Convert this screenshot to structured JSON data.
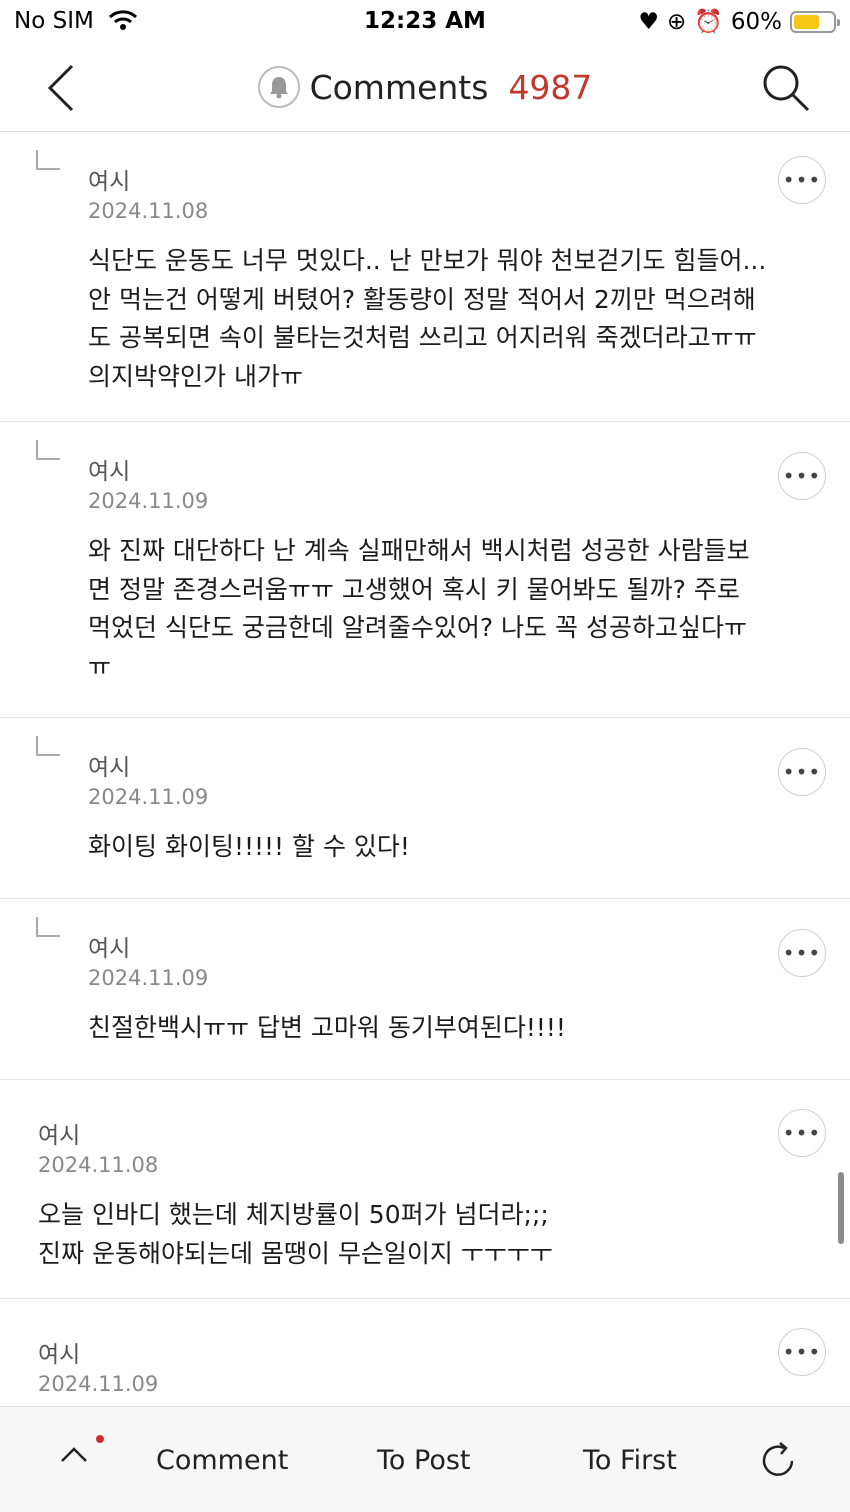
{
  "status_bar": {
    "carrier": "No SIM",
    "time": "12:23 AM",
    "battery": "60%"
  },
  "header": {
    "title": "Comments",
    "count": "4987"
  },
  "comments": [
    {
      "author": "여시",
      "date": "2024.11.08",
      "body": "식단도 운동도 너무 멋있다.. 난 만보가 뭐야 천보걷기도 힘들어...\n안 먹는건 어떻게 버텼어? 활동량이 정말 적어서 2끼만 먹으려해\n도 공복되면 속이 불타는것처럼 쓰리고 어지러워 죽겠더라고ㅠㅠ\n의지박약인가 내가ㅠ"
    },
    {
      "author": "여시",
      "date": "2024.11.09",
      "body": "와 진짜 대단하다 난 계속 실패만해서 백시처럼 성공한 사람들보\n면 정말 존경스러움ㅠㅠ 고생했어 혹시 키 물어봐도 될까? 주로\n먹었던 식단도 궁금한데 알려줄수있어? 나도 꼭 성공하고싶다ㅠ\nㅠ"
    },
    {
      "author": "여시",
      "date": "2024.11.09",
      "body": "화이팅 화이팅!!!!! 할 수 있다!"
    },
    {
      "author": "여시",
      "date": "2024.11.09",
      "body": "친절한백시ㅠㅠ 답변 고마워 동기부여된다!!!!"
    },
    {
      "author": "여시",
      "date": "2024.11.08",
      "body": "오늘 인바디 했는데 체지방률이 50퍼가 넘더라;;;\n진짜 운동해야되는데 몸땡이 무슨일이지 ㅜㅜㅜㅜ"
    },
    {
      "author": "여시",
      "date": "2024.11.09",
      "body": ""
    }
  ],
  "more_label": "•••",
  "bottom_bar": {
    "comment": "Comment",
    "to_post": "To Post",
    "to_first": "To First"
  },
  "colors": {
    "accent": "#c0392b",
    "notification_dot": "#d62b2b"
  }
}
